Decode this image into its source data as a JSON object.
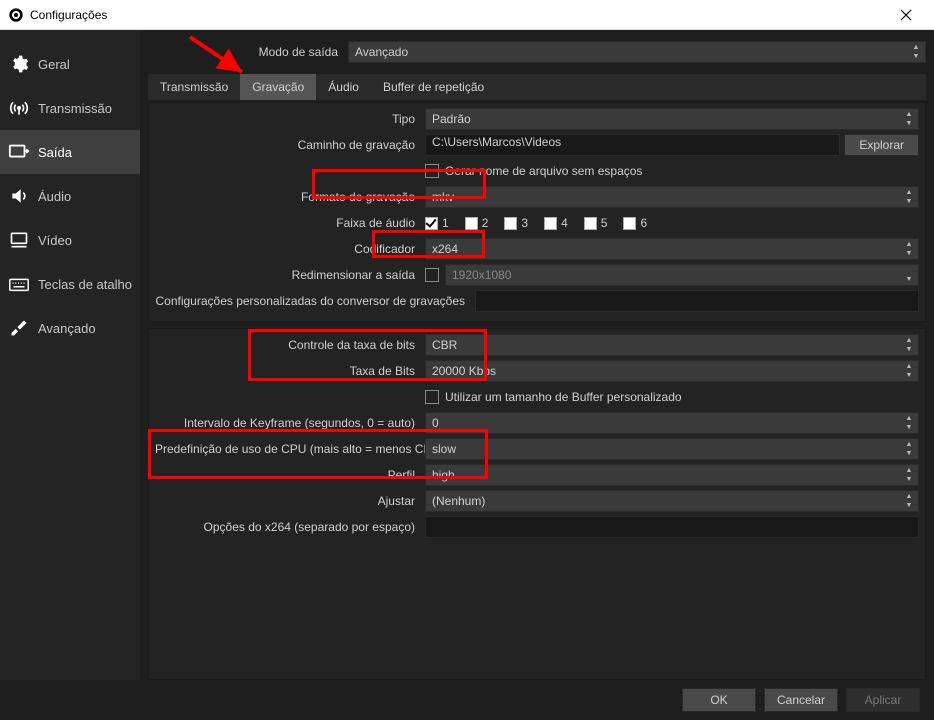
{
  "window": {
    "title": "Configurações"
  },
  "sidebar": {
    "items": [
      {
        "label": "Geral"
      },
      {
        "label": "Transmissão"
      },
      {
        "label": "Saída"
      },
      {
        "label": "Áudio"
      },
      {
        "label": "Vídeo"
      },
      {
        "label": "Teclas de atalho"
      },
      {
        "label": "Avançado"
      }
    ]
  },
  "output_mode": {
    "label": "Modo de saída",
    "value": "Avançado"
  },
  "tabs": [
    {
      "label": "Transmissão"
    },
    {
      "label": "Gravação"
    },
    {
      "label": "Áudio"
    },
    {
      "label": "Buffer de repetição"
    }
  ],
  "rec": {
    "type_label": "Tipo",
    "type_value": "Padrão",
    "path_label": "Caminho de gravação",
    "path_value": "C:\\Users\\Marcos\\Videos",
    "explore_btn": "Explorar",
    "no_spaces_label": "Gerar nome de arquivo sem espaços",
    "format_label": "Formato de gravação",
    "format_value": "mkv",
    "audio_track_label": "Faixa de áudio",
    "tracks": [
      "1",
      "2",
      "3",
      "4",
      "5",
      "6"
    ],
    "encoder_label": "Codificador",
    "encoder_value": "x264",
    "rescale_label": "Redimensionar a saída",
    "rescale_value": "1920x1080",
    "muxer_label": "Configurações personalizadas do conversor de gravações"
  },
  "enc": {
    "rate_control_label": "Controle da taxa de bits",
    "rate_control_value": "CBR",
    "bitrate_label": "Taxa de Bits",
    "bitrate_value": "20000 Kbps",
    "custom_buffer_label": "Utilizar um tamanho de Buffer personalizado",
    "keyframe_label": "Intervalo de Keyframe (segundos, 0 = auto)",
    "keyframe_value": "0",
    "cpu_preset_label": "Predefinição de uso de CPU (mais alto = menos CPU)",
    "cpu_preset_value": "slow",
    "profile_label": "Perfil",
    "profile_value": "high",
    "tune_label": "Ajustar",
    "tune_value": "(Nenhum)",
    "x264opts_label": "Opções do x264 (separado por espaço)"
  },
  "footer": {
    "ok": "OK",
    "cancel": "Cancelar",
    "apply": "Aplicar"
  }
}
